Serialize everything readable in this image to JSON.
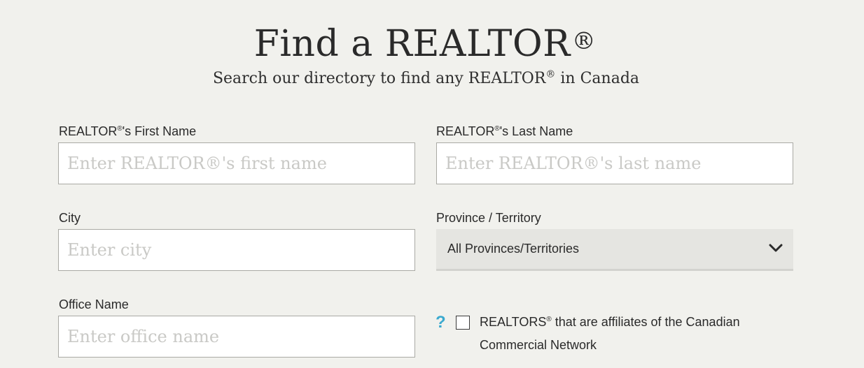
{
  "header": {
    "title": "Find a REALTOR",
    "title_reg": "®",
    "subtitle_pre": "Search our directory to find any REALTOR",
    "subtitle_reg": "®",
    "subtitle_post": " in Canada"
  },
  "form": {
    "first_name": {
      "label_pre": "REALTOR",
      "label_reg": "®",
      "label_post": "'s First Name",
      "placeholder": "Enter REALTOR®'s first name",
      "value": ""
    },
    "last_name": {
      "label_pre": "REALTOR",
      "label_reg": "®",
      "label_post": "'s Last Name",
      "placeholder": "Enter REALTOR®'s last name",
      "value": ""
    },
    "city": {
      "label": "City",
      "placeholder": "Enter city",
      "value": ""
    },
    "province": {
      "label": "Province / Territory",
      "selected": "All Provinces/Territories",
      "icon": "chevron-down-icon"
    },
    "office_name": {
      "label": "Office Name",
      "placeholder": "Enter office name",
      "value": ""
    },
    "ccn_affiliate": {
      "help_glyph": "?",
      "label_pre": "REALTORS",
      "label_reg": "®",
      "label_post": " that are affiliates of the Canadian Commercial Network",
      "checked": false
    }
  },
  "colors": {
    "background": "#f1f1ed",
    "help_accent": "#3aa9cf",
    "select_background": "#e5e5e1"
  }
}
